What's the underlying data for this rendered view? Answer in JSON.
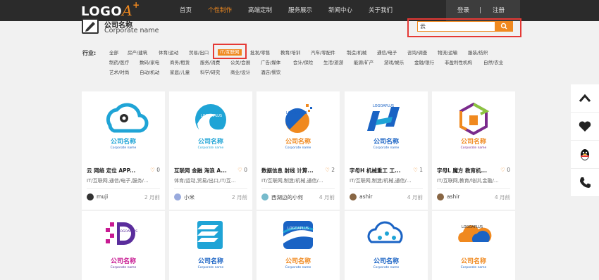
{
  "header": {
    "logo_text": "LOGO",
    "logo_a": "A",
    "logo_plus": "+",
    "nav": [
      "首页",
      "个性制作",
      "高端定制",
      "服务展示",
      "新闻中心",
      "关于我们"
    ],
    "active_nav": 1,
    "login": "登录",
    "separator": "|",
    "register": "注册"
  },
  "brand": {
    "name_cn": "公司名称",
    "name_en": "Corporate name"
  },
  "search": {
    "value": "云"
  },
  "filter": {
    "label": "行业:",
    "active": "IT/互联网",
    "row1": [
      "全部",
      "房产/建筑",
      "体育/运动",
      "贸易/出口",
      "IT/互联网",
      "批发/零售",
      "教育/培训",
      "汽车/零配件",
      "制造/机械",
      "通信/电子",
      "咨询/调查",
      "物流/运输",
      "服装/纺织"
    ],
    "row2": [
      "制药/医疗",
      "数码/家电",
      "商务/租赁",
      "服务/消费",
      "公关/会展",
      "广告/媒体",
      "会计/保险",
      "生活/旅游",
      "能源/矿产",
      "游戏/娱乐",
      "金融/银行",
      "非盈利性机构",
      "自然/农业"
    ],
    "row3": [
      "艺术/时尚",
      "自动/机动",
      "家庭/儿童",
      "科学/研究",
      "商业/设计",
      "酒店/餐饮"
    ]
  },
  "cards": [
    {
      "brand_cn": "公司名称",
      "brand_en": "Corporate name",
      "title": "云 网络 定位 APP...",
      "likes": "0",
      "categories": "IT/互联网,通信/电子,服务/...",
      "author": "muji",
      "time": "2 月前",
      "accent": "#1fa4d6"
    },
    {
      "brand_cn": "公司名称",
      "brand_en": "Corporate name",
      "title": "互联网 金融 海浪 A...",
      "likes": "0",
      "categories": "体育/运动,贸易/出口,IT/互...",
      "author": "小米",
      "time": "2 月前",
      "accent": "#1fa4d6"
    },
    {
      "brand_cn": "公司名称",
      "brand_en": "Corporate name",
      "title": "数据信息 射线 计算...",
      "likes": "2",
      "categories": "IT/互联网,制造/机械,通信/...",
      "author": "西湖边的小何",
      "time": "4 月前",
      "accent": "#f0891f"
    },
    {
      "brand_cn": "公司名称",
      "brand_en": "Corporate name",
      "title": "字母H 机械重工 工...",
      "likes": "1",
      "categories": "IT/互联网,制造/机械,通信/...",
      "author": "ashir",
      "time": "4 月前",
      "accent": "#1a63c4"
    },
    {
      "brand_cn": "公司名称",
      "brand_en": "Corporate name",
      "title": "字母L 魔方 教育机...",
      "likes": "0",
      "categories": "IT/互联网,教育/培训,金融/...",
      "author": "ashir",
      "time": "4 月前",
      "accent": "#f0891f"
    },
    {
      "brand_cn": "公司名称",
      "brand_en": "Corporate name",
      "accent": "#c81a92"
    },
    {
      "brand_cn": "公司名称",
      "brand_en": "Corporate name",
      "accent": "#1a63c4"
    },
    {
      "brand_cn": "公司名称",
      "brand_en": "Corporate name",
      "accent": "#f0891f"
    },
    {
      "brand_cn": "公司名称",
      "brand_en": "Corporate name",
      "accent": "#1a63c4"
    },
    {
      "brand_cn": "公司名称",
      "brand_en": "Corporate name",
      "accent": "#f0891f"
    }
  ],
  "side_tools": [
    "arrow-up-icon",
    "heart-icon",
    "qq-icon",
    "phone-icon"
  ],
  "colors": {
    "accent": "#f0891f",
    "nav_bg": "#2b2b2b",
    "highlight": "#e53935"
  }
}
